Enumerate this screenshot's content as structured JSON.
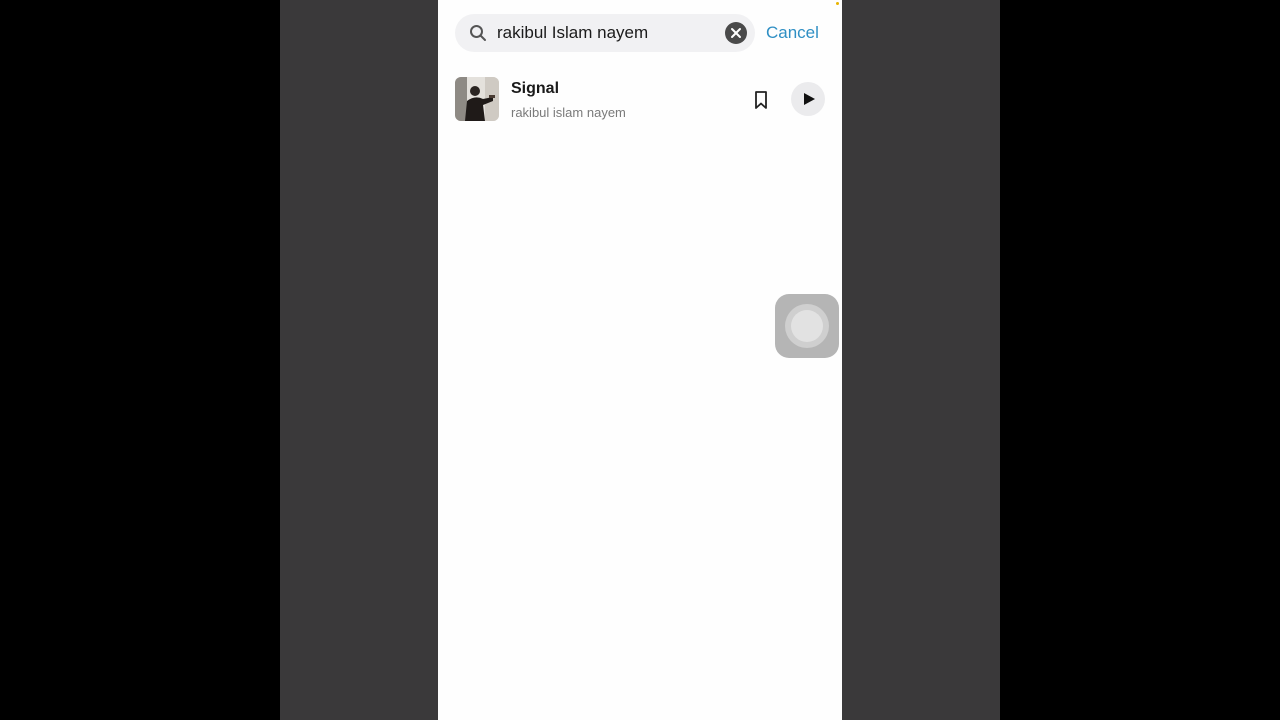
{
  "search": {
    "value": "rakibul Islam nayem",
    "cancel_label": "Cancel"
  },
  "results": [
    {
      "title": "Signal",
      "artist": "rakibul islam nayem",
      "icons": {
        "save": "bookmark-icon",
        "play": "play-icon"
      }
    }
  ],
  "colors": {
    "accent": "#2f8fc4",
    "side_panels": "#3a393a",
    "phone_background": "#fefefe",
    "search_background": "#f1f1f3"
  }
}
